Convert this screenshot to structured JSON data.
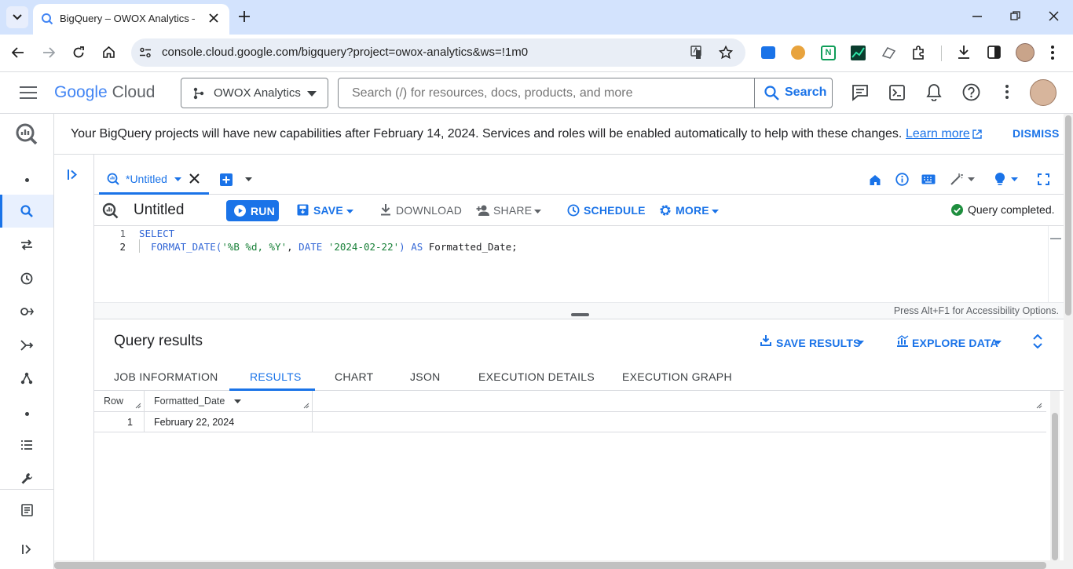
{
  "browser": {
    "tab_title": "BigQuery – OWOX Analytics – G",
    "url": "console.cloud.google.com/bigquery?project=owox-analytics&ws=!1m0"
  },
  "header": {
    "logo_google": "Google",
    "logo_cloud": "Cloud",
    "project": "OWOX Analytics",
    "search_placeholder": "Search (/) for resources, docs, products, and more",
    "search_button": "Search"
  },
  "banner": {
    "message": "Your BigQuery projects will have new capabilities after February 14, 2024. Services and roles will be enabled automatically to help with these changes.",
    "learn_more": "Learn more",
    "dismiss": "DISMISS"
  },
  "editor_tab": {
    "label": "*Untitled"
  },
  "toolbar": {
    "title": "Untitled",
    "run": "RUN",
    "save": "SAVE",
    "download": "DOWNLOAD",
    "share": "SHARE",
    "schedule": "SCHEDULE",
    "more": "MORE",
    "status": "Query completed."
  },
  "editor": {
    "lines": [
      {
        "num": "1",
        "text": "SELECT"
      },
      {
        "num": "2",
        "text": "FORMAT_DATE('%B %d, %Y', DATE '2024-02-22') AS Formatted_Date;"
      }
    ],
    "line2_parts": {
      "fn": "FORMAT_DATE(",
      "str1": "'%B %d, %Y'",
      "comma": ", ",
      "kw": "DATE ",
      "str2": "'2024-02-22'",
      "close": ") ",
      "as": "AS ",
      "ident": "Formatted_Date;"
    },
    "hint": "Press Alt+F1 for Accessibility Options."
  },
  "results": {
    "title": "Query results",
    "save_results": "SAVE RESULTS",
    "explore_data": "EXPLORE DATA",
    "tabs": [
      "JOB INFORMATION",
      "RESULTS",
      "CHART",
      "JSON",
      "EXECUTION DETAILS",
      "EXECUTION GRAPH"
    ],
    "active_tab": "RESULTS",
    "columns": [
      "Row",
      "Formatted_Date"
    ],
    "rows": [
      [
        "1",
        "February 22, 2024"
      ]
    ]
  },
  "colors": {
    "accent": "#1a73e8",
    "success": "#1e8e3e",
    "tab_bar": "#d3e3fd"
  }
}
